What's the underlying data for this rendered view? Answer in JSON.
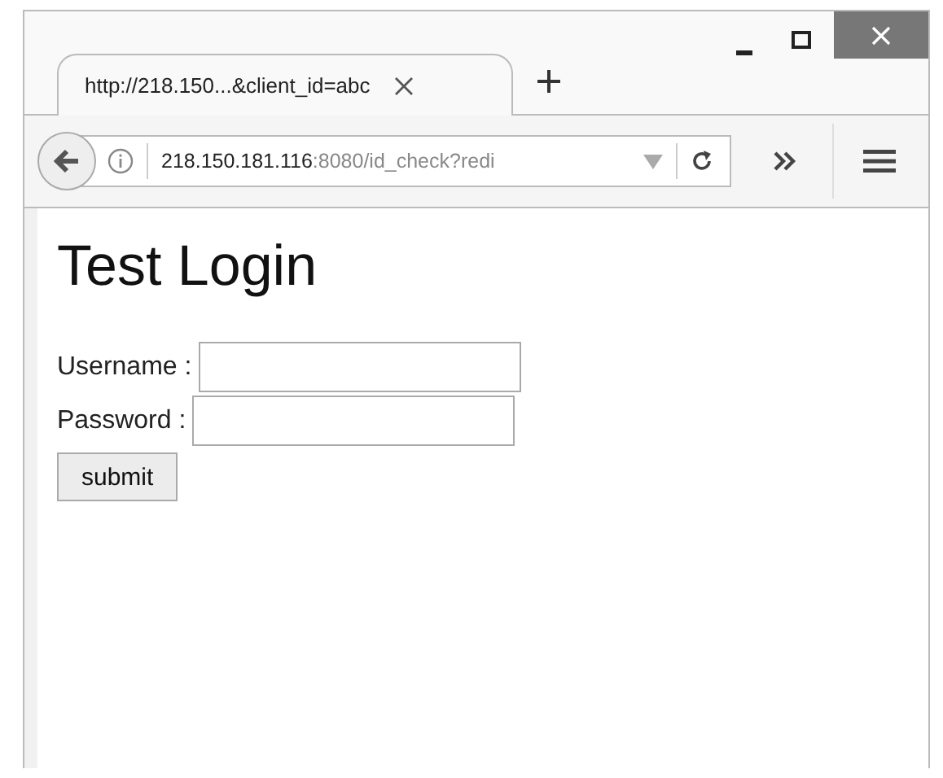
{
  "tab": {
    "title": "http://218.150...&client_id=abc"
  },
  "address": {
    "host": "218.150.181.116",
    "rest": ":8080/id_check?redi"
  },
  "page": {
    "heading": "Test Login",
    "fields": [
      {
        "label": "Username :"
      },
      {
        "label": "Password :"
      }
    ],
    "button": "submit"
  }
}
